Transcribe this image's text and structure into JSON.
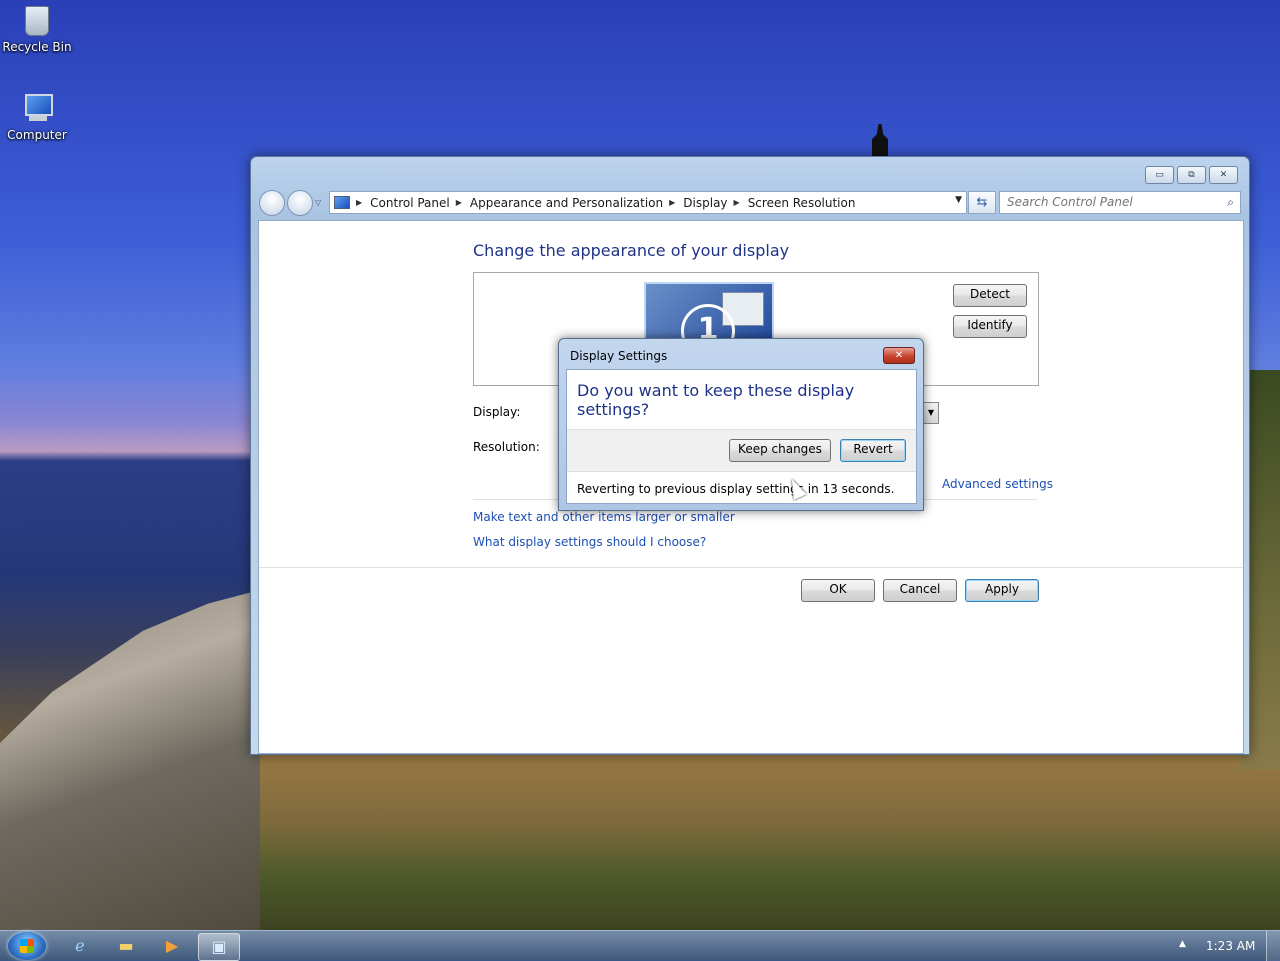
{
  "desktop": {
    "icons": [
      {
        "label": "Recycle Bin",
        "icon": "recycle-bin-icon"
      },
      {
        "label": "Computer",
        "icon": "computer-icon"
      }
    ]
  },
  "window": {
    "caption_buttons": {
      "minimize": "▭",
      "restore": "⧉",
      "close": "✕"
    },
    "breadcrumb": [
      "Control Panel",
      "Appearance and Personalization",
      "Display",
      "Screen Resolution"
    ],
    "search": {
      "placeholder": "Search Control Panel"
    },
    "heading": "Change the appearance of your display",
    "monitor_number": "1",
    "detect_label": "Detect",
    "identify_label": "Identify",
    "display_label": "Display:",
    "resolution_label": "Resolution:",
    "advanced_link": "Advanced settings",
    "links": [
      "Make text and other items larger or smaller",
      "What display settings should I choose?"
    ],
    "ok_label": "OK",
    "cancel_label": "Cancel",
    "apply_label": "Apply"
  },
  "dialog": {
    "title": "Display Settings",
    "question": "Do you want to keep these display settings?",
    "keep_label": "Keep changes",
    "revert_label": "Revert",
    "footer": "Reverting to previous display settings in 13 seconds."
  },
  "taskbar": {
    "pinned": [
      "internet-explorer-icon",
      "windows-explorer-icon",
      "media-player-icon",
      "display-settings-icon"
    ],
    "clock": "1:23 AM"
  }
}
